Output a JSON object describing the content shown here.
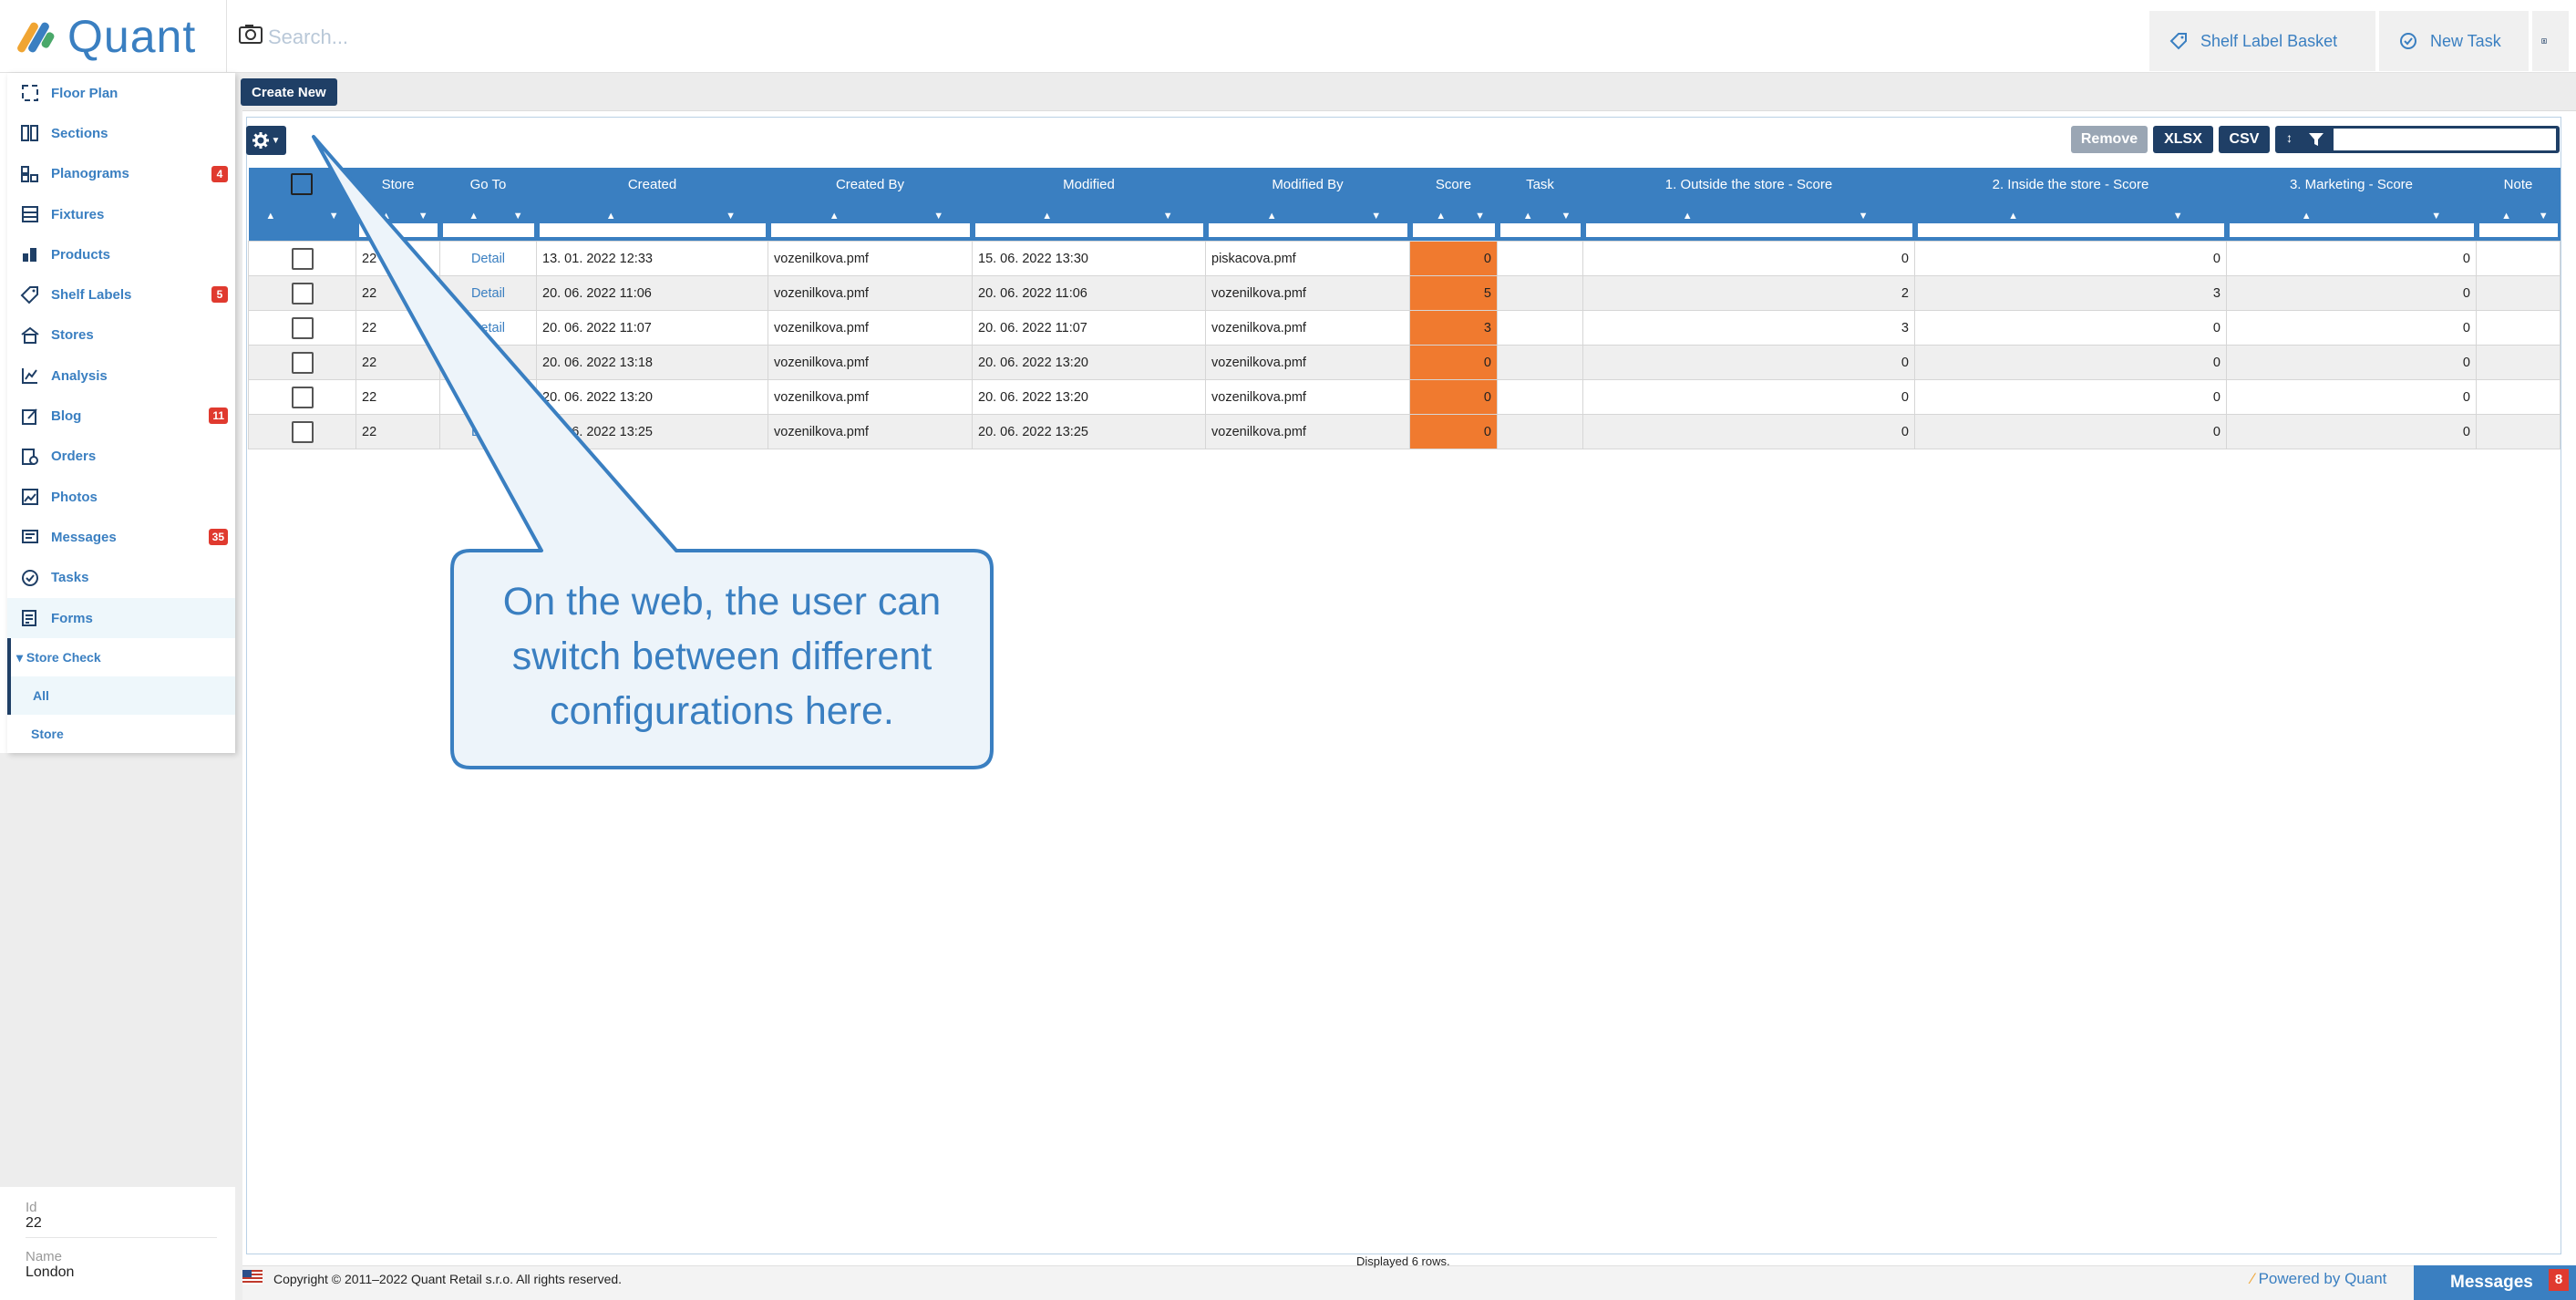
{
  "app": {
    "name": "Quant"
  },
  "search": {
    "placeholder": "Search..."
  },
  "topbar": {
    "shelf_label_basket": "Shelf Label Basket",
    "new_task": "New Task"
  },
  "sidebar": {
    "items": [
      {
        "label": "Floor Plan",
        "icon": "floor-plan-icon"
      },
      {
        "label": "Sections",
        "icon": "sections-icon"
      },
      {
        "label": "Planograms",
        "icon": "planograms-icon",
        "badge": "4"
      },
      {
        "label": "Fixtures",
        "icon": "fixtures-icon"
      },
      {
        "label": "Products",
        "icon": "products-icon"
      },
      {
        "label": "Shelf Labels",
        "icon": "tag-icon",
        "badge": "5"
      },
      {
        "label": "Stores",
        "icon": "store-icon"
      },
      {
        "label": "Analysis",
        "icon": "analysis-icon"
      },
      {
        "label": "Blog",
        "icon": "blog-icon",
        "badge": "11"
      },
      {
        "label": "Orders",
        "icon": "orders-icon"
      },
      {
        "label": "Photos",
        "icon": "photos-icon"
      },
      {
        "label": "Messages",
        "icon": "messages-icon",
        "badge": "35"
      },
      {
        "label": "Tasks",
        "icon": "tasks-icon"
      },
      {
        "label": "Forms",
        "icon": "forms-icon"
      }
    ],
    "group": "▾ Store Check",
    "subitems": [
      "All",
      "Store"
    ],
    "details": {
      "id_label": "Id",
      "id_value": "22",
      "name_label": "Name",
      "name_value": "London"
    }
  },
  "toolbar": {
    "create_new": "Create New",
    "remove": "Remove",
    "xlsx": "XLSX",
    "csv": "CSV"
  },
  "grid": {
    "columns": [
      "Store",
      "Go To",
      "Created",
      "Created By",
      "Modified",
      "Modified By",
      "Score",
      "Task",
      "1. Outside the store - Score",
      "2. Inside the store - Score",
      "3. Marketing - Score",
      "Note"
    ],
    "rows": [
      {
        "store": "22",
        "goto": "Detail",
        "created": "13. 01. 2022 12:33",
        "created_by": "vozenilkova.pmf",
        "modified": "15. 06. 2022 13:30",
        "modified_by": "piskacova.pmf",
        "score": "0",
        "task": "",
        "s1": "0",
        "s2": "0",
        "s3": "0",
        "note": ""
      },
      {
        "store": "22",
        "goto": "Detail",
        "created": "20. 06. 2022 11:06",
        "created_by": "vozenilkova.pmf",
        "modified": "20. 06. 2022 11:06",
        "modified_by": "vozenilkova.pmf",
        "score": "5",
        "task": "",
        "s1": "2",
        "s2": "3",
        "s3": "0",
        "note": ""
      },
      {
        "store": "22",
        "goto": "Detail",
        "created": "20. 06. 2022 11:07",
        "created_by": "vozenilkova.pmf",
        "modified": "20. 06. 2022 11:07",
        "modified_by": "vozenilkova.pmf",
        "score": "3",
        "task": "",
        "s1": "3",
        "s2": "0",
        "s3": "0",
        "note": ""
      },
      {
        "store": "22",
        "goto": "Detail",
        "created": "20. 06. 2022 13:18",
        "created_by": "vozenilkova.pmf",
        "modified": "20. 06. 2022 13:20",
        "modified_by": "vozenilkova.pmf",
        "score": "0",
        "task": "",
        "s1": "0",
        "s2": "0",
        "s3": "0",
        "note": ""
      },
      {
        "store": "22",
        "goto": "Detail",
        "created": "20. 06. 2022 13:20",
        "created_by": "vozenilkova.pmf",
        "modified": "20. 06. 2022 13:20",
        "modified_by": "vozenilkova.pmf",
        "score": "0",
        "task": "",
        "s1": "0",
        "s2": "0",
        "s3": "0",
        "note": ""
      },
      {
        "store": "22",
        "goto": "Detail",
        "created": "20. 06. 2022 13:25",
        "created_by": "vozenilkova.pmf",
        "modified": "20. 06. 2022 13:25",
        "modified_by": "vozenilkova.pmf",
        "score": "0",
        "task": "",
        "s1": "0",
        "s2": "0",
        "s3": "0",
        "note": ""
      }
    ],
    "rows_info": "Displayed 6 rows."
  },
  "callout": {
    "text": "On the web, the user can switch between different configurations here."
  },
  "footer": {
    "copyright": "Copyright © 2011–2022 Quant Retail s.r.o. All rights reserved.",
    "powered": "Powered by Quant",
    "messages": "Messages",
    "messages_count": "8"
  },
  "colors": {
    "accent": "#3a7fc1",
    "dark": "#1f3f66",
    "score": "#f07a2f",
    "badge": "#e03a2f",
    "remove": "#9aa6b4"
  }
}
